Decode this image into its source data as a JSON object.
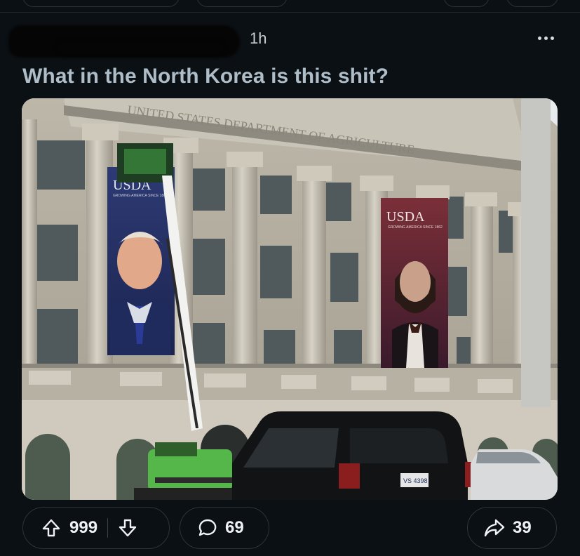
{
  "post": {
    "timestamp": "1h",
    "title": "What in the North Korea is this shit?",
    "image": {
      "building_inscription": "UNITED STATES DEPARTMENT OF AGRICULTURE",
      "left_banner_text": "USDA",
      "left_banner_subtext": "GROWING AMERICA SINCE 1862",
      "right_banner_text": "USDA",
      "right_banner_subtext": "GROWING AMERICA SINCE 1862",
      "license_plate": "VS 4398"
    }
  },
  "actions": {
    "upvote_count": "999",
    "comment_count": "69",
    "share_count": "39"
  },
  "icons": {
    "more": "more-horizontal-icon",
    "upvote": "arrow-up-icon",
    "downvote": "arrow-down-icon",
    "comment": "speech-bubble-icon",
    "share": "share-arrow-icon"
  },
  "colors": {
    "background": "#0b1014",
    "title": "#aebdc8",
    "pill_border": "#2c343a"
  }
}
